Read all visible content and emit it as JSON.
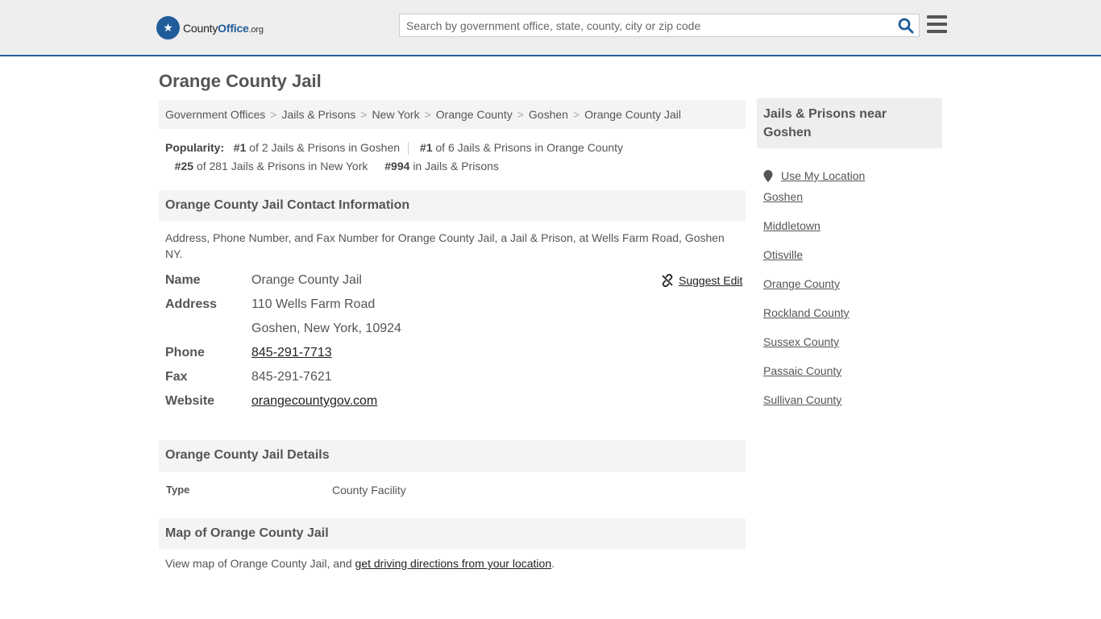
{
  "header": {
    "logo": {
      "brand_prefix": "County",
      "brand_main": "Office",
      "brand_suffix": ".org",
      "icon": "eagle-badge-icon"
    },
    "search": {
      "placeholder": "Search by government office, state, county, city or zip code",
      "value": "",
      "icon": "search-icon"
    },
    "menu_icon": "hamburger-menu-icon"
  },
  "page": {
    "title": "Orange County Jail"
  },
  "breadcrumb": [
    "Government Offices",
    "Jails & Prisons",
    "New York",
    "Orange County",
    "Goshen",
    "Orange County Jail"
  ],
  "popularity": {
    "label": "Popularity:",
    "items": [
      {
        "rank": "#1",
        "text": "of 2 Jails & Prisons in Goshen"
      },
      {
        "rank": "#1",
        "text": "of 6 Jails & Prisons in Orange County"
      },
      {
        "rank": "#25",
        "text": "of 281 Jails & Prisons in New York"
      },
      {
        "rank": "#994",
        "text": "in Jails & Prisons"
      }
    ]
  },
  "contact": {
    "heading": "Orange County Jail Contact Information",
    "description": "Address, Phone Number, and Fax Number for Orange County Jail, a Jail & Prison, at Wells Farm Road, Goshen NY.",
    "suggest_edit": "Suggest Edit",
    "fields": {
      "name_label": "Name",
      "name": "Orange County Jail",
      "address_label": "Address",
      "address_line1": "110 Wells Farm Road",
      "address_line2": "Goshen, New York, 10924",
      "phone_label": "Phone",
      "phone": "845-291-7713",
      "fax_label": "Fax",
      "fax": "845-291-7621",
      "website_label": "Website",
      "website": "orangecountygov.com"
    }
  },
  "details": {
    "heading": "Orange County Jail Details",
    "type_label": "Type",
    "type_value": "County Facility"
  },
  "map": {
    "heading": "Map of Orange County Jail",
    "text_before": "View map of Orange County Jail, and ",
    "link": "get driving directions from your location",
    "text_after": "."
  },
  "sidebar": {
    "heading": "Jails & Prisons near Goshen",
    "use_location": "Use My Location",
    "links": [
      "Goshen",
      "Middletown",
      "Otisville",
      "Orange County",
      "Rockland County",
      "Sussex County",
      "Passaic County",
      "Sullivan County"
    ]
  }
}
